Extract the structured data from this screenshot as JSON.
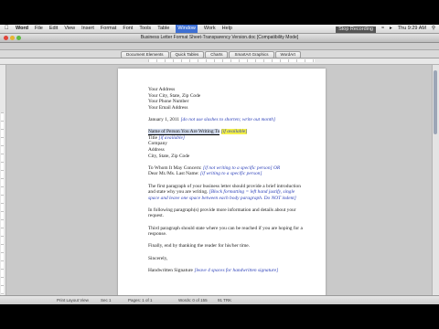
{
  "menubar": {
    "app": "Word",
    "menus": [
      "File",
      "Edit",
      "View",
      "Insert",
      "Format",
      "Font",
      "Tools",
      "Table",
      "Window",
      "Work",
      "Help"
    ],
    "active_menu": "Window",
    "extras": "Stop Recording",
    "clock": "Thu 9:29 AM"
  },
  "window": {
    "title": "Business Letter Format Sheet-Transparency Version.doc [Compatibility Mode]",
    "lights": [
      "#e0443a",
      "#e6b431",
      "#5fbb43"
    ]
  },
  "gallery": {
    "tabs": [
      "Document Elements",
      "Quick Tables",
      "Charts",
      "SmartArt Graphics",
      "WordArt"
    ]
  },
  "letter": {
    "return_address": [
      "Your Address",
      "Your City, State, Zip Code",
      "Your Phone Number",
      "Your Email Address"
    ],
    "date": "January 1, 2011",
    "date_note": "[do not use slashes to shorten; write out month]",
    "recipient_name": "Name of Person You Are Writing To",
    "recipient_note": "[if available]",
    "recipient_title": "Title",
    "recipient_title_note": "[if available]",
    "recipient_lines": [
      "Company",
      "Address",
      "City, State, Zip Code"
    ],
    "salutation_1": "To Whom It May Concern:",
    "salutation_1_note": "[if not writing to a specific person] OR",
    "salutation_2": "Dear Mr./Ms. Last Name:",
    "salutation_2_note": "[if writing to a specific person]",
    "para1": "The first paragraph of your business letter should provide a brief introduction and state why you are writing.",
    "para1_note": "[Block formatting = left hand justify, single space and leave one space between each body paragraph. Do NOT indent]",
    "para2": "In following paragraph(s) provide more information and details about your request.",
    "para3": "Third paragraph should state where you can be reached if you are hoping for a response.",
    "para4": "Finally, end by thanking the reader for his/her time.",
    "closing": "Sincerely,",
    "signature": "Handwritten Signature",
    "signature_note": "[leave 4 spaces for handwritten signature]"
  },
  "statusbar": {
    "view": "Print Layout View",
    "sec": "Sec  1",
    "pages": "Pages:  1 of 1",
    "words": "Words:  0 of 155",
    "zoom": "91 TRK"
  }
}
